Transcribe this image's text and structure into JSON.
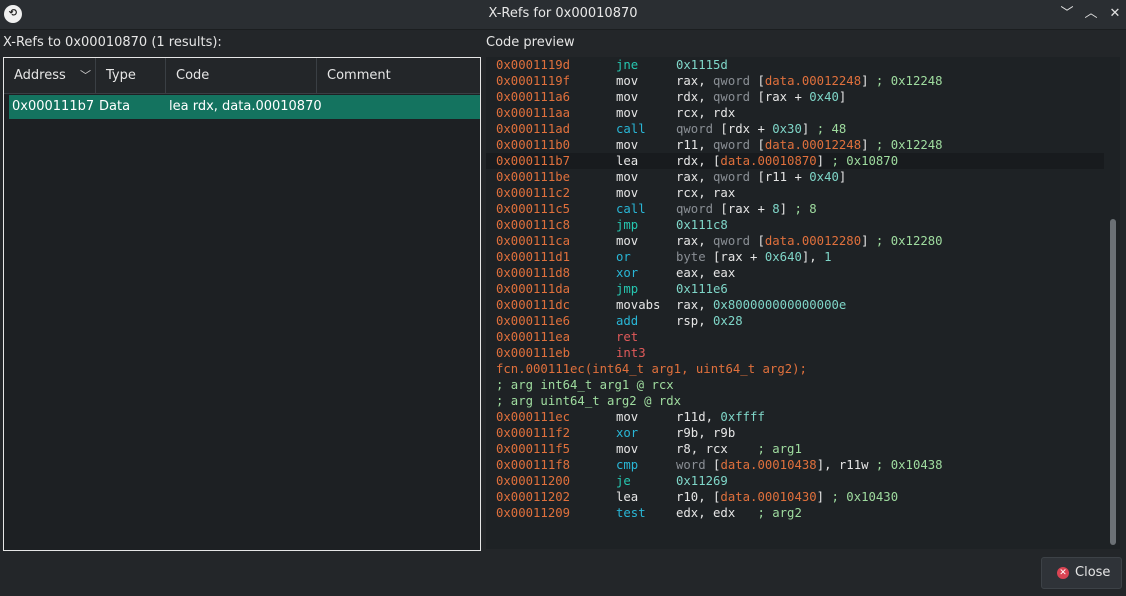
{
  "window": {
    "title": "X-Refs for 0x00010870",
    "icon_name": "app-logo-icon",
    "minimize_glyph": "﹀",
    "maximize_glyph": "︿",
    "close_glyph": "✕"
  },
  "left_panel": {
    "label": "X-Refs to 0x00010870 (1 results):",
    "columns": [
      "Address",
      "Type",
      "Code",
      "Comment"
    ],
    "rows": [
      {
        "address": "0x000111b7",
        "type": "Data",
        "code": "lea rdx, data.00010870",
        "comment": ""
      }
    ]
  },
  "right_panel": {
    "label": "Code preview"
  },
  "code_lines": [
    {
      "addr": "0x0001119d",
      "mn": "jne",
      "ops": [
        [
          "num",
          "0x1115d"
        ]
      ],
      "kind": "jmp"
    },
    {
      "addr": "0x0001119f",
      "mn": "mov",
      "ops": [
        [
          "reg",
          "rax, "
        ],
        [
          "kw",
          "qword "
        ],
        [
          "reg",
          "["
        ],
        [
          "sym",
          "data.00012248"
        ],
        [
          "reg",
          "] "
        ],
        [
          "cmt",
          "; 0x12248"
        ]
      ],
      "kind": "mov"
    },
    {
      "addr": "0x000111a6",
      "mn": "mov",
      "ops": [
        [
          "reg",
          "rdx, "
        ],
        [
          "kw",
          "qword "
        ],
        [
          "reg",
          "[rax + "
        ],
        [
          "num",
          "0x40"
        ],
        [
          "reg",
          "]"
        ]
      ],
      "kind": "mov"
    },
    {
      "addr": "0x000111aa",
      "mn": "mov",
      "ops": [
        [
          "reg",
          "rcx, rdx"
        ]
      ],
      "kind": "mov"
    },
    {
      "addr": "0x000111ad",
      "mn": "call",
      "ops": [
        [
          "kw",
          "qword "
        ],
        [
          "reg",
          "[rdx + "
        ],
        [
          "num",
          "0x30"
        ],
        [
          "reg",
          "] "
        ],
        [
          "cmt",
          "; 48"
        ]
      ],
      "kind": "call"
    },
    {
      "addr": "0x000111b0",
      "mn": "mov",
      "ops": [
        [
          "reg",
          "r11, "
        ],
        [
          "kw",
          "qword "
        ],
        [
          "reg",
          "["
        ],
        [
          "sym",
          "data.00012248"
        ],
        [
          "reg",
          "] "
        ],
        [
          "cmt",
          "; 0x12248"
        ]
      ],
      "kind": "mov"
    },
    {
      "addr": "0x000111b7",
      "mn": "lea",
      "ops": [
        [
          "reg",
          "rdx, ["
        ],
        [
          "sym",
          "data.00010870"
        ],
        [
          "reg",
          "] "
        ],
        [
          "cmt",
          "; 0x10870"
        ]
      ],
      "kind": "mov",
      "highlight": true
    },
    {
      "addr": "0x000111be",
      "mn": "mov",
      "ops": [
        [
          "reg",
          "rax, "
        ],
        [
          "kw",
          "qword "
        ],
        [
          "reg",
          "[r11 + "
        ],
        [
          "num",
          "0x40"
        ],
        [
          "reg",
          "]"
        ]
      ],
      "kind": "mov"
    },
    {
      "addr": "0x000111c2",
      "mn": "mov",
      "ops": [
        [
          "reg",
          "rcx, rax"
        ]
      ],
      "kind": "mov"
    },
    {
      "addr": "0x000111c5",
      "mn": "call",
      "ops": [
        [
          "kw",
          "qword "
        ],
        [
          "reg",
          "[rax + "
        ],
        [
          "num",
          "8"
        ],
        [
          "reg",
          "] "
        ],
        [
          "cmt",
          "; 8"
        ]
      ],
      "kind": "call"
    },
    {
      "addr": "0x000111c8",
      "mn": "jmp",
      "ops": [
        [
          "num",
          "0x111c8"
        ]
      ],
      "kind": "jmp"
    },
    {
      "addr": "0x000111ca",
      "mn": "mov",
      "ops": [
        [
          "reg",
          "rax, "
        ],
        [
          "kw",
          "qword "
        ],
        [
          "reg",
          "["
        ],
        [
          "sym",
          "data.00012280"
        ],
        [
          "reg",
          "] "
        ],
        [
          "cmt",
          "; 0x12280"
        ]
      ],
      "kind": "mov"
    },
    {
      "addr": "0x000111d1",
      "mn": "or",
      "ops": [
        [
          "kw",
          "byte "
        ],
        [
          "reg",
          "[rax + "
        ],
        [
          "num",
          "0x640"
        ],
        [
          "reg",
          "], "
        ],
        [
          "num",
          "1"
        ]
      ],
      "kind": "call"
    },
    {
      "addr": "0x000111d8",
      "mn": "xor",
      "ops": [
        [
          "reg",
          "eax, eax"
        ]
      ],
      "kind": "call"
    },
    {
      "addr": "0x000111da",
      "mn": "jmp",
      "ops": [
        [
          "num",
          "0x111e6"
        ]
      ],
      "kind": "jmp"
    },
    {
      "addr": "0x000111dc",
      "mn": "movabs",
      "ops": [
        [
          "reg",
          "rax, "
        ],
        [
          "num",
          "0x800000000000000e"
        ]
      ],
      "kind": "mov"
    },
    {
      "addr": "0x000111e6",
      "mn": "add",
      "ops": [
        [
          "reg",
          "rsp, "
        ],
        [
          "num",
          "0x28"
        ]
      ],
      "kind": "call"
    },
    {
      "addr": "0x000111ea",
      "mn": "ret",
      "ops": [],
      "kind": "ret"
    },
    {
      "addr": "0x000111eb",
      "mn": "int3",
      "ops": [],
      "kind": "ret"
    },
    {
      "raw": "fcn.000111ec(int64_t arg1, uint64_t arg2);",
      "kind": "fn"
    },
    {
      "raw": "; arg int64_t arg1 @ rcx",
      "kind": "cmt"
    },
    {
      "raw": "; arg uint64_t arg2 @ rdx",
      "kind": "cmt"
    },
    {
      "addr": "0x000111ec",
      "mn": "mov",
      "ops": [
        [
          "reg",
          "r11d, "
        ],
        [
          "num",
          "0xffff"
        ]
      ],
      "kind": "mov"
    },
    {
      "addr": "0x000111f2",
      "mn": "xor",
      "ops": [
        [
          "reg",
          "r9b, r9b"
        ]
      ],
      "kind": "call"
    },
    {
      "addr": "0x000111f5",
      "mn": "mov",
      "ops": [
        [
          "reg",
          "r8, rcx    "
        ],
        [
          "cmt",
          "; arg1"
        ]
      ],
      "kind": "mov"
    },
    {
      "addr": "0x000111f8",
      "mn": "cmp",
      "ops": [
        [
          "kw",
          "word "
        ],
        [
          "reg",
          "["
        ],
        [
          "sym",
          "data.00010438"
        ],
        [
          "reg",
          "], r11w "
        ],
        [
          "cmt",
          "; 0x10438"
        ]
      ],
      "kind": "call"
    },
    {
      "addr": "0x00011200",
      "mn": "je",
      "ops": [
        [
          "num",
          "0x11269"
        ]
      ],
      "kind": "jmp"
    },
    {
      "addr": "0x00011202",
      "mn": "lea",
      "ops": [
        [
          "reg",
          "r10, ["
        ],
        [
          "sym",
          "data.00010430"
        ],
        [
          "reg",
          "] "
        ],
        [
          "cmt",
          "; 0x10430"
        ]
      ],
      "kind": "mov"
    },
    {
      "addr": "0x00011209",
      "mn": "test",
      "ops": [
        [
          "reg",
          "edx, edx   "
        ],
        [
          "cmt",
          "; arg2"
        ]
      ],
      "kind": "call"
    }
  ],
  "buttons": {
    "close_label": "Close"
  },
  "colors": {
    "selection": "#14735f",
    "address": "#e0703c",
    "jump": "#26c6b0",
    "call": "#29b6d6"
  }
}
